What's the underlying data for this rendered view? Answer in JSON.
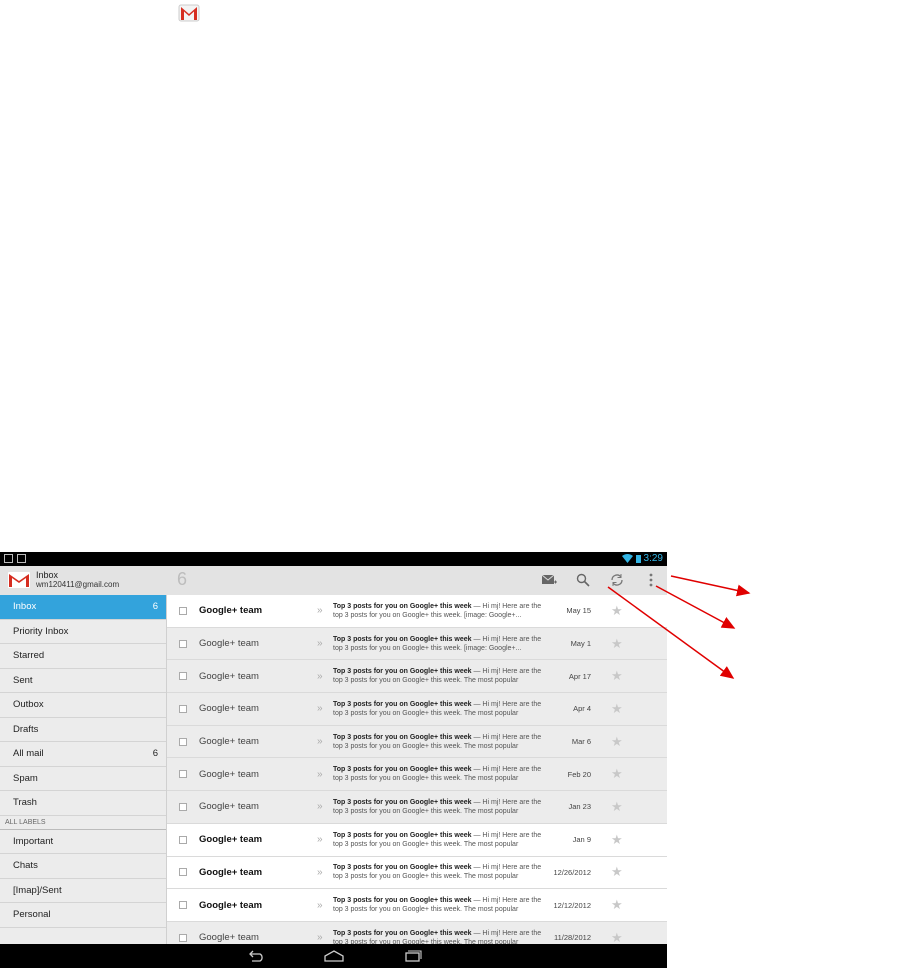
{
  "status": {
    "time": "3:29"
  },
  "account": {
    "title": "Inbox",
    "email": "wm120411@gmail.com"
  },
  "unread_count": "6",
  "labels_header": "ALL LABELS",
  "nav": [
    {
      "label": "Inbox",
      "count": "6",
      "active": true
    },
    {
      "label": "Priority Inbox",
      "count": ""
    },
    {
      "label": "Starred",
      "count": ""
    },
    {
      "label": "Sent",
      "count": ""
    },
    {
      "label": "Outbox",
      "count": ""
    },
    {
      "label": "Drafts",
      "count": ""
    },
    {
      "label": "All mail",
      "count": "6"
    },
    {
      "label": "Spam",
      "count": ""
    },
    {
      "label": "Trash",
      "count": ""
    }
  ],
  "labels": [
    {
      "label": "Important"
    },
    {
      "label": "Chats"
    },
    {
      "label": "[Imap]/Sent"
    },
    {
      "label": "Personal"
    }
  ],
  "emails": [
    {
      "sender": "Google+ team",
      "subject": "Top 3 posts for you on Google+ this week",
      "snippet1": " — Hi mj! Here are the",
      "snippet2": "top 3 posts for you on Google+ this week. [image: Google+...",
      "date": "May 15",
      "unread": true
    },
    {
      "sender": "Google+ team",
      "subject": "Top 3 posts for you on Google+ this week",
      "snippet1": " — Hi mj! Here are the",
      "snippet2": "top 3 posts for you on Google+ this week. [image: Google+...",
      "date": "May 1",
      "unread": false
    },
    {
      "sender": "Google+ team",
      "subject": "Top 3 posts for you on Google+ this week",
      "snippet1": " — Hi mj! Here are the",
      "snippet2": "top 3 posts for you on Google+ this week. The most popular",
      "date": "Apr 17",
      "unread": false
    },
    {
      "sender": "Google+ team",
      "subject": "Top 3 posts for you on Google+ this week",
      "snippet1": " — Hi mj! Here are the",
      "snippet2": "top 3 posts for you on Google+ this week. The most popular",
      "date": "Apr 4",
      "unread": false
    },
    {
      "sender": "Google+ team",
      "subject": "Top 3 posts for you on Google+ this week",
      "snippet1": " — Hi mj! Here are the",
      "snippet2": "top 3 posts for you on Google+ this week. The most popular",
      "date": "Mar 6",
      "unread": false
    },
    {
      "sender": "Google+ team",
      "subject": "Top 3 posts for you on Google+ this week",
      "snippet1": " — Hi mj! Here are the",
      "snippet2": "top 3 posts for you on Google+ this week. The most popular",
      "date": "Feb 20",
      "unread": false
    },
    {
      "sender": "Google+ team",
      "subject": "Top 3 posts for you on Google+ this week",
      "snippet1": " — Hi mj! Here are the",
      "snippet2": "top 3 posts for you on Google+ this week. The most popular",
      "date": "Jan 23",
      "unread": false
    },
    {
      "sender": "Google+ team",
      "subject": "Top 3 posts for you on Google+ this week",
      "snippet1": " — Hi mj! Here are the",
      "snippet2": "top 3 posts for you on Google+ this week. The most popular",
      "date": "Jan 9",
      "unread": true
    },
    {
      "sender": "Google+ team",
      "subject": "Top 3 posts for you on Google+ this week",
      "snippet1": " — Hi mj! Here are the",
      "snippet2": "top 3 posts for you on Google+ this week. The most popular",
      "date": "12/26/2012",
      "unread": true
    },
    {
      "sender": "Google+ team",
      "subject": "Top 3 posts for you on Google+ this week",
      "snippet1": " — Hi mj! Here are the",
      "snippet2": "top 3 posts for you on Google+ this week. The most popular",
      "date": "12/12/2012",
      "unread": true
    },
    {
      "sender": "Google+ team",
      "subject": "Top 3 posts for you on Google+ this week",
      "snippet1": " — Hi mj! Here are the",
      "snippet2": "top 3 posts for you on Google+ this week. The most popular",
      "date": "11/28/2012",
      "unread": false
    }
  ],
  "colors": {
    "accent": "#33a3dc",
    "arrow": "#e00000"
  }
}
